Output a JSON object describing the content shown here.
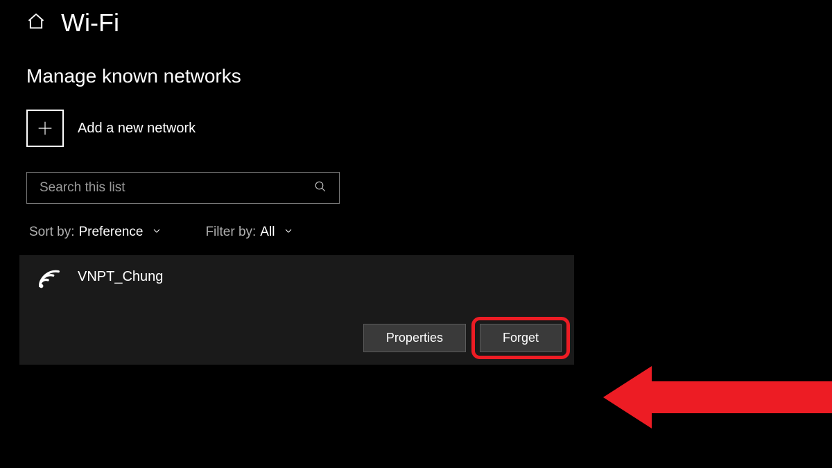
{
  "header": {
    "title": "Wi-Fi"
  },
  "subtitle": "Manage known networks",
  "add_network": {
    "label": "Add a new network"
  },
  "search": {
    "placeholder": "Search this list"
  },
  "sort": {
    "label": "Sort by:",
    "value": "Preference"
  },
  "filter": {
    "label": "Filter by:",
    "value": "All"
  },
  "network": {
    "name": "VNPT_Chung",
    "properties_label": "Properties",
    "forget_label": "Forget"
  }
}
